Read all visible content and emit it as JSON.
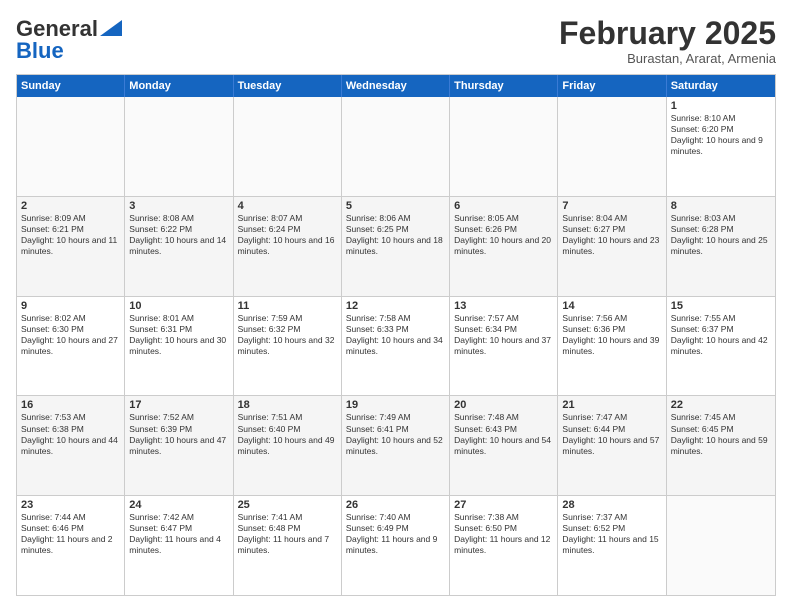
{
  "logo": {
    "general": "General",
    "blue": "Blue"
  },
  "header": {
    "month": "February 2025",
    "location": "Burastan, Ararat, Armenia"
  },
  "weekdays": [
    "Sunday",
    "Monday",
    "Tuesday",
    "Wednesday",
    "Thursday",
    "Friday",
    "Saturday"
  ],
  "weeks": [
    [
      {
        "day": "",
        "text": ""
      },
      {
        "day": "",
        "text": ""
      },
      {
        "day": "",
        "text": ""
      },
      {
        "day": "",
        "text": ""
      },
      {
        "day": "",
        "text": ""
      },
      {
        "day": "",
        "text": ""
      },
      {
        "day": "1",
        "text": "Sunrise: 8:10 AM\nSunset: 6:20 PM\nDaylight: 10 hours and 9 minutes."
      }
    ],
    [
      {
        "day": "2",
        "text": "Sunrise: 8:09 AM\nSunset: 6:21 PM\nDaylight: 10 hours and 11 minutes."
      },
      {
        "day": "3",
        "text": "Sunrise: 8:08 AM\nSunset: 6:22 PM\nDaylight: 10 hours and 14 minutes."
      },
      {
        "day": "4",
        "text": "Sunrise: 8:07 AM\nSunset: 6:24 PM\nDaylight: 10 hours and 16 minutes."
      },
      {
        "day": "5",
        "text": "Sunrise: 8:06 AM\nSunset: 6:25 PM\nDaylight: 10 hours and 18 minutes."
      },
      {
        "day": "6",
        "text": "Sunrise: 8:05 AM\nSunset: 6:26 PM\nDaylight: 10 hours and 20 minutes."
      },
      {
        "day": "7",
        "text": "Sunrise: 8:04 AM\nSunset: 6:27 PM\nDaylight: 10 hours and 23 minutes."
      },
      {
        "day": "8",
        "text": "Sunrise: 8:03 AM\nSunset: 6:28 PM\nDaylight: 10 hours and 25 minutes."
      }
    ],
    [
      {
        "day": "9",
        "text": "Sunrise: 8:02 AM\nSunset: 6:30 PM\nDaylight: 10 hours and 27 minutes."
      },
      {
        "day": "10",
        "text": "Sunrise: 8:01 AM\nSunset: 6:31 PM\nDaylight: 10 hours and 30 minutes."
      },
      {
        "day": "11",
        "text": "Sunrise: 7:59 AM\nSunset: 6:32 PM\nDaylight: 10 hours and 32 minutes."
      },
      {
        "day": "12",
        "text": "Sunrise: 7:58 AM\nSunset: 6:33 PM\nDaylight: 10 hours and 34 minutes."
      },
      {
        "day": "13",
        "text": "Sunrise: 7:57 AM\nSunset: 6:34 PM\nDaylight: 10 hours and 37 minutes."
      },
      {
        "day": "14",
        "text": "Sunrise: 7:56 AM\nSunset: 6:36 PM\nDaylight: 10 hours and 39 minutes."
      },
      {
        "day": "15",
        "text": "Sunrise: 7:55 AM\nSunset: 6:37 PM\nDaylight: 10 hours and 42 minutes."
      }
    ],
    [
      {
        "day": "16",
        "text": "Sunrise: 7:53 AM\nSunset: 6:38 PM\nDaylight: 10 hours and 44 minutes."
      },
      {
        "day": "17",
        "text": "Sunrise: 7:52 AM\nSunset: 6:39 PM\nDaylight: 10 hours and 47 minutes."
      },
      {
        "day": "18",
        "text": "Sunrise: 7:51 AM\nSunset: 6:40 PM\nDaylight: 10 hours and 49 minutes."
      },
      {
        "day": "19",
        "text": "Sunrise: 7:49 AM\nSunset: 6:41 PM\nDaylight: 10 hours and 52 minutes."
      },
      {
        "day": "20",
        "text": "Sunrise: 7:48 AM\nSunset: 6:43 PM\nDaylight: 10 hours and 54 minutes."
      },
      {
        "day": "21",
        "text": "Sunrise: 7:47 AM\nSunset: 6:44 PM\nDaylight: 10 hours and 57 minutes."
      },
      {
        "day": "22",
        "text": "Sunrise: 7:45 AM\nSunset: 6:45 PM\nDaylight: 10 hours and 59 minutes."
      }
    ],
    [
      {
        "day": "23",
        "text": "Sunrise: 7:44 AM\nSunset: 6:46 PM\nDaylight: 11 hours and 2 minutes."
      },
      {
        "day": "24",
        "text": "Sunrise: 7:42 AM\nSunset: 6:47 PM\nDaylight: 11 hours and 4 minutes."
      },
      {
        "day": "25",
        "text": "Sunrise: 7:41 AM\nSunset: 6:48 PM\nDaylight: 11 hours and 7 minutes."
      },
      {
        "day": "26",
        "text": "Sunrise: 7:40 AM\nSunset: 6:49 PM\nDaylight: 11 hours and 9 minutes."
      },
      {
        "day": "27",
        "text": "Sunrise: 7:38 AM\nSunset: 6:50 PM\nDaylight: 11 hours and 12 minutes."
      },
      {
        "day": "28",
        "text": "Sunrise: 7:37 AM\nSunset: 6:52 PM\nDaylight: 11 hours and 15 minutes."
      },
      {
        "day": "",
        "text": ""
      }
    ]
  ]
}
